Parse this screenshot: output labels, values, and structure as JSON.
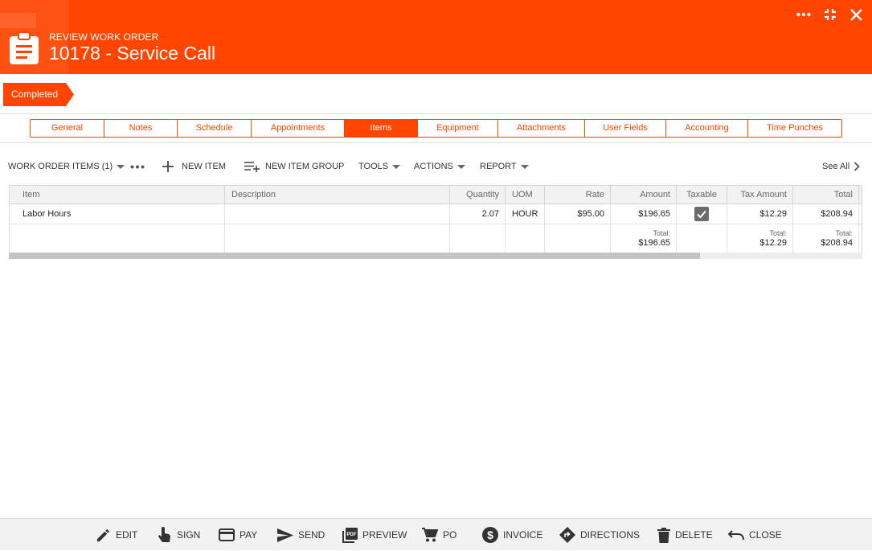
{
  "header": {
    "subtitle": "REVIEW WORK ORDER",
    "title": "10178 - Service Call",
    "accent_color": "#ff4500",
    "icon": "clipboard-icon",
    "controls": [
      "more-icon",
      "collapse-icon",
      "close-icon"
    ]
  },
  "status": {
    "label": "Completed"
  },
  "tabs": [
    {
      "label": "General"
    },
    {
      "label": "Notes"
    },
    {
      "label": "Schedule"
    },
    {
      "label": "Appointments"
    },
    {
      "label": "Items",
      "active": true
    },
    {
      "label": "Equipment"
    },
    {
      "label": "Attachments"
    },
    {
      "label": "User Fields"
    },
    {
      "label": "Accounting"
    },
    {
      "label": "Time Punches"
    }
  ],
  "toolbar": {
    "work_order_items": "WORK ORDER ITEMS (1)",
    "new_item": "NEW ITEM",
    "new_item_group": "NEW ITEM GROUP",
    "tools": "TOOLS",
    "actions": "ACTIONS",
    "report": "REPORT",
    "see_all": "See All"
  },
  "grid": {
    "columns": [
      "Item",
      "Description",
      "Quantity",
      "UOM",
      "Rate",
      "Amount",
      "Taxable",
      "Tax Amount",
      "Total"
    ],
    "rows": [
      {
        "item": "Labor Hours",
        "description": "",
        "quantity": "2.07",
        "uom": "HOUR",
        "rate": "$95.00",
        "amount": "$196.65",
        "taxable": true,
        "tax_amount": "$12.29",
        "total": "$208.94"
      }
    ],
    "totals": {
      "label": "Total:",
      "amount": "$196.65",
      "tax_amount": "$12.29",
      "total": "$208.94"
    }
  },
  "bottom_bar": {
    "edit": "EDIT",
    "sign": "SIGN",
    "pay": "PAY",
    "send": "SEND",
    "preview": "PREVIEW",
    "po": "PO",
    "invoice": "INVOICE",
    "directions": "DIRECTIONS",
    "delete": "DELETE",
    "close": "CLOSE"
  }
}
